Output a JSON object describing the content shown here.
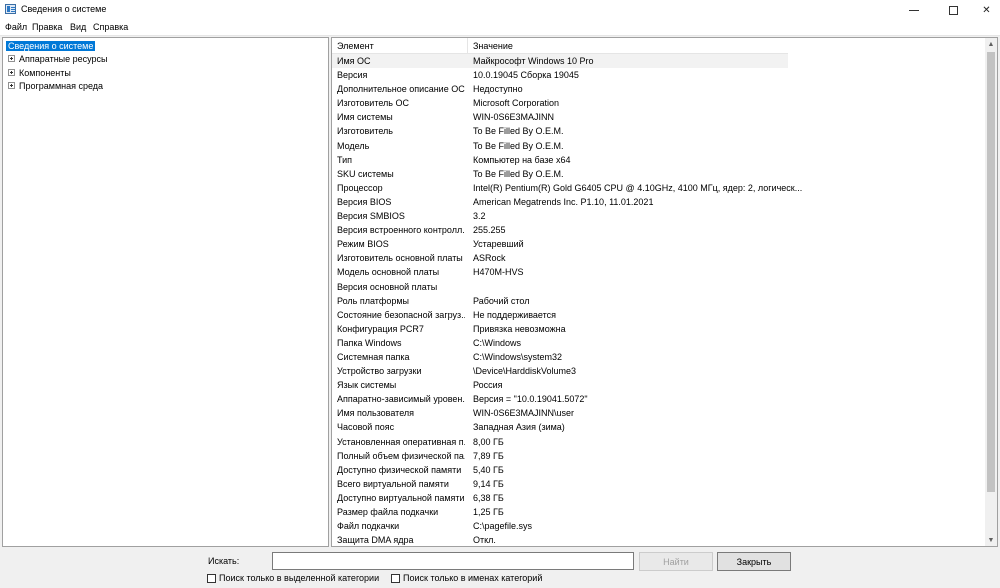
{
  "window": {
    "title": "Сведения о системе",
    "icon": "system-info-icon",
    "controls": {
      "minimize": "minimize-icon",
      "maximize": "maximize-icon",
      "close": "✕"
    }
  },
  "menu": [
    "Файл",
    "Правка",
    "Вид",
    "Справка"
  ],
  "tree": {
    "selected": "Сведения о системе",
    "children": [
      "Аппаратные ресурсы",
      "Компоненты",
      "Программная среда"
    ]
  },
  "table": {
    "headers": [
      "Элемент",
      "Значение"
    ],
    "rows": [
      [
        "Имя ОС",
        "Майкрософт Windows 10 Pro"
      ],
      [
        "Версия",
        "10.0.19045 Сборка 19045"
      ],
      [
        "Дополнительное описание ОС",
        "Недоступно"
      ],
      [
        "Изготовитель ОС",
        "Microsoft Corporation"
      ],
      [
        "Имя системы",
        "WIN-0S6E3MAJINN"
      ],
      [
        "Изготовитель",
        "To Be Filled By O.E.M."
      ],
      [
        "Модель",
        "To Be Filled By O.E.M."
      ],
      [
        "Тип",
        "Компьютер на базе x64"
      ],
      [
        "SKU системы",
        "To Be Filled By O.E.M."
      ],
      [
        "Процессор",
        "Intel(R) Pentium(R) Gold G6405 CPU @ 4.10GHz, 4100 МГц, ядер: 2, логическ..."
      ],
      [
        "Версия BIOS",
        "American Megatrends Inc. P1.10, 11.01.2021"
      ],
      [
        "Версия SMBIOS",
        "3.2"
      ],
      [
        "Версия встроенного контролл...",
        "255.255"
      ],
      [
        "Режим BIOS",
        "Устаревший"
      ],
      [
        "Изготовитель основной платы",
        "ASRock"
      ],
      [
        "Модель основной платы",
        "H470M-HVS"
      ],
      [
        "Версия основной платы",
        ""
      ],
      [
        "Роль платформы",
        "Рабочий стол"
      ],
      [
        "Состояние безопасной загруз...",
        "Не поддерживается"
      ],
      [
        "Конфигурация PCR7",
        "Привязка невозможна"
      ],
      [
        "Папка Windows",
        "C:\\Windows"
      ],
      [
        "Системная папка",
        "C:\\Windows\\system32"
      ],
      [
        "Устройство загрузки",
        "\\Device\\HarddiskVolume3"
      ],
      [
        "Язык системы",
        "Россия"
      ],
      [
        "Аппаратно-зависимый уровен...",
        "Версия = \"10.0.19041.5072\""
      ],
      [
        "Имя пользователя",
        "WIN-0S6E3MAJINN\\user"
      ],
      [
        "Часовой пояс",
        "Западная Азия (зима)"
      ],
      [
        "Установленная оперативная п...",
        "8,00 ГБ"
      ],
      [
        "Полный объем физической па...",
        "7,89 ГБ"
      ],
      [
        "Доступно физической памяти",
        "5,40 ГБ"
      ],
      [
        "Всего виртуальной памяти",
        "9,14 ГБ"
      ],
      [
        "Доступно виртуальной памяти",
        "6,38 ГБ"
      ],
      [
        "Размер файла подкачки",
        "1,25 ГБ"
      ],
      [
        "Файл подкачки",
        "C:\\pagefile.sys"
      ],
      [
        "Защита DMA ядра",
        "Откл."
      ]
    ]
  },
  "search": {
    "label": "Искать:",
    "value": "",
    "find_button": "Найти",
    "close_button": "Закрыть",
    "check_selected_category": "Поиск только в выделенной категории",
    "check_category_names": "Поиск только в именах категорий"
  }
}
